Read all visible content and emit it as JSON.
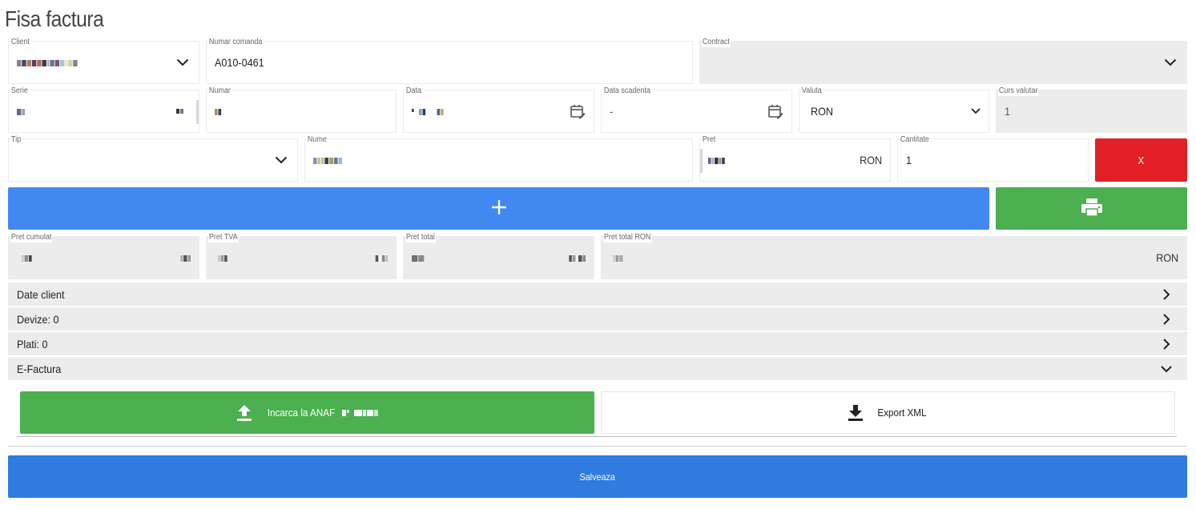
{
  "page": {
    "title": "Fisa factura"
  },
  "row1": {
    "client": {
      "label": "Client",
      "value": ""
    },
    "numar_comanda": {
      "label": "Numar comanda",
      "value": "A010-0461"
    },
    "contract": {
      "label": "Contract",
      "value": ""
    }
  },
  "row2": {
    "serie": {
      "label": "Serie",
      "value": ""
    },
    "numar": {
      "label": "Numar",
      "value": ""
    },
    "data": {
      "label": "Data",
      "value": ""
    },
    "data_scadenta": {
      "label": "Data scadenta",
      "value": "-"
    },
    "valuta": {
      "label": "Valuta",
      "value": "RON"
    },
    "curs_valutar": {
      "label": "Curs valutar",
      "value": "1"
    }
  },
  "row3": {
    "tip": {
      "label": "Tip",
      "value": ""
    },
    "nume": {
      "label": "Nume",
      "value": ""
    },
    "pret": {
      "label": "Pret",
      "value": "",
      "currency": "RON"
    },
    "cantitate": {
      "label": "Cantitate",
      "value": "1"
    },
    "remove_label": "X"
  },
  "actions": {
    "add_icon": "plus-icon",
    "print_icon": "printer-icon"
  },
  "totals": {
    "pret_cumulat": {
      "label": "Pret cumulat"
    },
    "pret_tva": {
      "label": "Pret TVA"
    },
    "pret_total": {
      "label": "Pret total"
    },
    "pret_total_ron": {
      "label": "Pret total RON",
      "currency": "RON"
    }
  },
  "accordion": [
    {
      "label": "Date client",
      "state": "collapsed"
    },
    {
      "label": "Devize: 0",
      "state": "collapsed"
    },
    {
      "label": "Plati: 0",
      "state": "collapsed"
    },
    {
      "label": "E-Factura",
      "state": "expanded"
    }
  ],
  "efactura": {
    "upload_label": "Incarca la ANAF",
    "export_label": "Export XML"
  },
  "save_label": "Salveaza",
  "colors": {
    "blue": "#4189f0",
    "blue_save": "#2f7be0",
    "green": "#4caf50",
    "red": "#e31e24",
    "field_disabled": "#ececec"
  }
}
